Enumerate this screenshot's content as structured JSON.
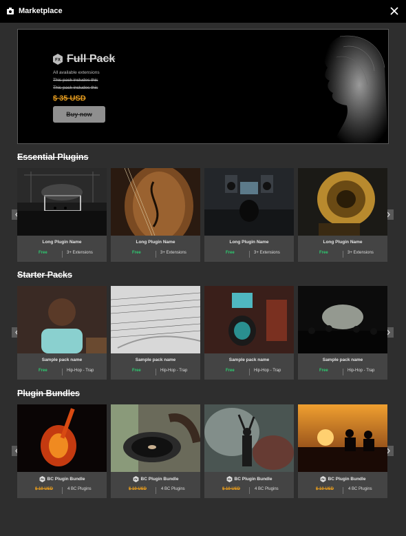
{
  "app": {
    "title": "Marketplace"
  },
  "hero": {
    "title": "Full Pack",
    "lines": [
      "All available extensions",
      "This pack includes this",
      "This pack includes this"
    ],
    "price": "$ 35 USD",
    "button": "Buy now"
  },
  "sections": {
    "essential": {
      "title": "Essential Plugins",
      "cards": [
        {
          "name": "Long Plugin Name",
          "price": "Free",
          "detail": "3+ Extensions"
        },
        {
          "name": "Long Plugin Name",
          "price": "Free",
          "detail": "3+ Extensions"
        },
        {
          "name": "Long Plugin Name",
          "price": "Free",
          "detail": "3+ Extensions"
        },
        {
          "name": "Long Plugin Name",
          "price": "Free",
          "detail": "3+ Extensions"
        }
      ]
    },
    "starter": {
      "title": "Starter Packs",
      "cards": [
        {
          "name": "Sample pack name",
          "price": "Free",
          "detail": "Hip-Hop - Trap"
        },
        {
          "name": "Sample pack name",
          "price": "Free",
          "detail": "Hip-Hop - Trap"
        },
        {
          "name": "Sample pack name",
          "price": "Free",
          "detail": "Hip-Hop - Trap"
        },
        {
          "name": "Sample pack name",
          "price": "Free",
          "detail": "Hip-Hop - Trap"
        }
      ]
    },
    "bundles": {
      "title": "Plugin Bundles",
      "cards": [
        {
          "name": "BC Plugin Bundle",
          "price": "$ 10 USD",
          "detail": "4 BC Plugins"
        },
        {
          "name": "BC Plugin Bundle",
          "price": "$ 10 USD",
          "detail": "4 BC Plugins"
        },
        {
          "name": "BC Plugin Bundle",
          "price": "$ 10 USD",
          "detail": "4 BC Plugins"
        },
        {
          "name": "BC Plugin Bundle",
          "price": "$ 10 USD",
          "detail": "4 BC Plugins"
        }
      ]
    }
  },
  "colors": {
    "accent_price": "#e39a1e",
    "free": "#2ecc71",
    "card": "#444444",
    "background": "#2e2e2e"
  },
  "icons": [
    "marketplace-icon",
    "close-icon",
    "fx-badge-icon",
    "chevron-left-icon",
    "chevron-right-icon"
  ]
}
